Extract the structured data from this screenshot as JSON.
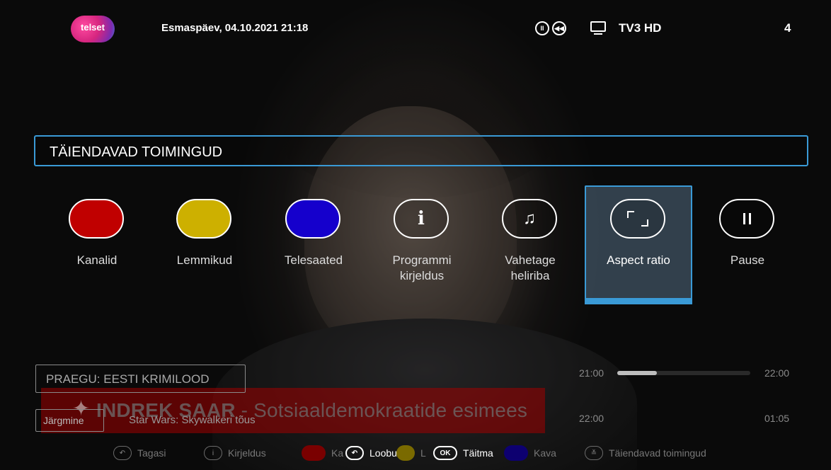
{
  "header": {
    "logo_text": "telset",
    "datetime": "Esmaspäev, 04.10.2021  21:18",
    "channel_name": "TV3 HD",
    "channel_number": "4",
    "dvr_icons": [
      "pause-circle-icon",
      "rewind-circle-icon"
    ]
  },
  "menu": {
    "title": "TÄIENDAVAD TOIMINGUD",
    "actions": [
      {
        "label": "Kanalid",
        "icon": "red-button",
        "color": "#c00000"
      },
      {
        "label": "Lemmikud",
        "icon": "yellow-button",
        "color": "#cdb000"
      },
      {
        "label": "Telesaated",
        "icon": "blue-button",
        "color": "#1500cc"
      },
      {
        "label": "Programmi kirjeldus",
        "icon": "info-icon",
        "glyph": "i"
      },
      {
        "label": "Vahetage heliriba",
        "icon": "music-note-icon",
        "glyph": "♫"
      },
      {
        "label": "Aspect ratio",
        "icon": "aspect-ratio-icon",
        "selected": true
      },
      {
        "label": "Pause",
        "icon": "pause-icon"
      }
    ],
    "accent_color": "#3a9ad6"
  },
  "info": {
    "now_label": "PRAEGU: EESTI KRIMILOOD",
    "headline_bold": "INDREK SAAR",
    "headline_rest": " - Sotsiaaldemokraatide esimees",
    "next_label": "Järgmine",
    "next_title": "Star Wars: Skywalkeri tõus",
    "now_start": "21:00",
    "now_end": "22:00",
    "now_progress": 0.3,
    "next_start": "22:00",
    "next_end": "01:05"
  },
  "footer": {
    "back": "Tagasi",
    "details": "Kirjeldus",
    "cancel": "Loobu",
    "ok_key": "OK",
    "execute": "Täitma",
    "schedule": "Kava",
    "more_actions": "Täiendavad toimingud",
    "red_partial": "Ka",
    "yellow_partial": "L",
    "yellow_partial_end": "ik"
  }
}
